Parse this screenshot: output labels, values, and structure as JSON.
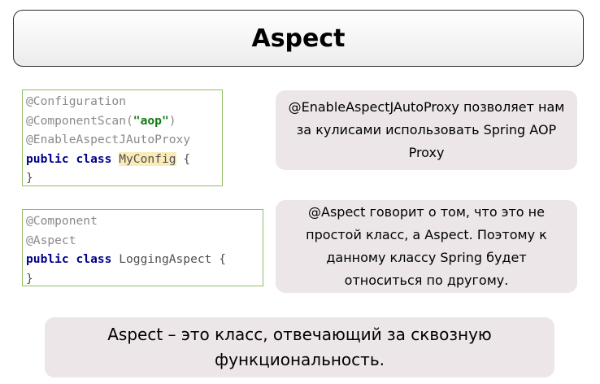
{
  "title": "Aspect",
  "config_code": {
    "line1": "@Configuration",
    "line2_annotation": "@ComponentScan(",
    "line2_string": "\"aop\"",
    "line2_close": ")",
    "line3": "@EnableAspectJAutoProxy",
    "line4_keyword": "public class",
    "line4_space": " ",
    "line4_classname": "MyConfig",
    "line4_brace": " {",
    "line5": "}"
  },
  "aspect_code": {
    "line1": "@Component",
    "line2": "@Aspect",
    "line3_keyword": "public class",
    "line3_rest": " LoggingAspect {",
    "line4": "}"
  },
  "notes": {
    "enable_proxy": "@EnableAspectJAutoProxy позволяет нам за кулисами использовать Spring AOP Proxy",
    "aspect_annotation": "@Aspect говорит о том, что это не простой класс, а Aspect. Поэтому к данному классу Spring будет относиться по другому.",
    "definition": "Aspect – это класс, отвечающий за сквозную функциональность."
  }
}
